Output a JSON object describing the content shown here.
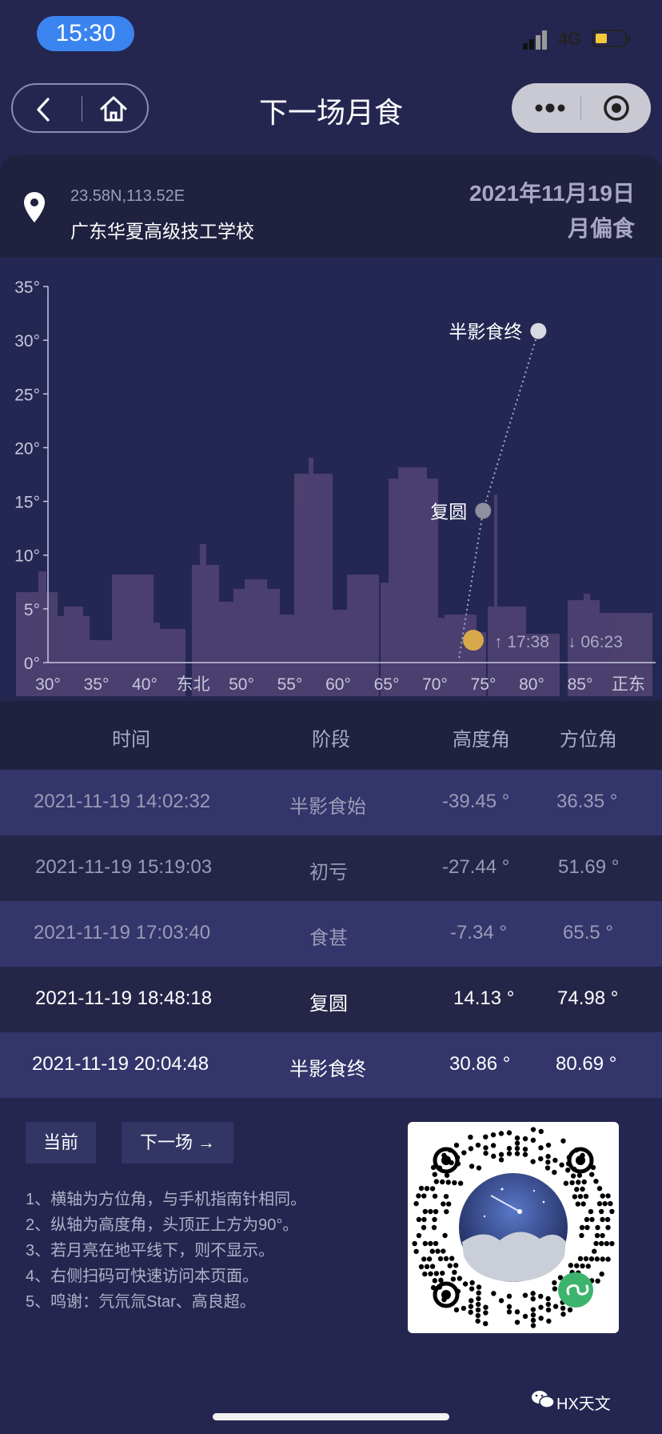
{
  "status_bar": {
    "time": "15:30",
    "network": "4G"
  },
  "nav": {
    "title": "下一场月食"
  },
  "location": {
    "coords": "23.58N,113.52E",
    "name": "广东华夏高级技工学校"
  },
  "eclipse": {
    "date": "2021年11月19日",
    "type": "月偏食"
  },
  "chart_data": {
    "type": "scatter",
    "y_ticks": [
      "35°",
      "30°",
      "25°",
      "20°",
      "15°",
      "10°",
      "5°",
      "0°"
    ],
    "x_ticks": [
      "30°",
      "35°",
      "40°",
      "东北",
      "50°",
      "55°",
      "60°",
      "65°",
      "70°",
      "75°",
      "80°",
      "85°",
      "正东"
    ],
    "xlim": [
      30,
      90
    ],
    "ylim": [
      0,
      35
    ],
    "points": [
      {
        "label": "复圆",
        "azimuth": 74.98,
        "altitude": 14.13
      },
      {
        "label": "半影食终",
        "azimuth": 80.69,
        "altitude": 30.86
      }
    ],
    "moon_info": {
      "rise": "↑ 17:38",
      "set": "↓ 06:23"
    }
  },
  "table": {
    "headers": [
      "时间",
      "阶段",
      "高度角",
      "方位角"
    ],
    "rows": [
      {
        "time": "2021-11-19 14:02:32",
        "phase": "半影食始",
        "altitude": "-39.45 °",
        "azimuth": "36.35 °"
      },
      {
        "time": "2021-11-19 15:19:03",
        "phase": "初亏",
        "altitude": "-27.44 °",
        "azimuth": "51.69 °"
      },
      {
        "time": "2021-11-19 17:03:40",
        "phase": "食甚",
        "altitude": "-7.34 °",
        "azimuth": "65.5 °"
      },
      {
        "time": "2021-11-19 18:48:18",
        "phase": "复圆",
        "altitude": "14.13 °",
        "azimuth": "74.98 °"
      },
      {
        "time": "2021-11-19 20:04:48",
        "phase": "半影食终",
        "altitude": "30.86 °",
        "azimuth": "80.69 °"
      }
    ]
  },
  "buttons": {
    "current": "当前",
    "next": "下一场 →"
  },
  "notes": [
    "1、横轴为方位角，与手机指南针相同。",
    "2、纵轴为高度角，头顶正上方为90°。",
    "3、若月亮在地平线下，则不显示。",
    "4、右侧扫码可快速访问本页面。",
    "5、鸣谢：氕氘氚Star、高良超。"
  ],
  "watermark": "HX天文",
  "colors": {
    "accent_blue": "#3a84f0",
    "moon": "#d8a94a",
    "skyline": "#5a4a7a",
    "row_alt": "#34356a"
  }
}
